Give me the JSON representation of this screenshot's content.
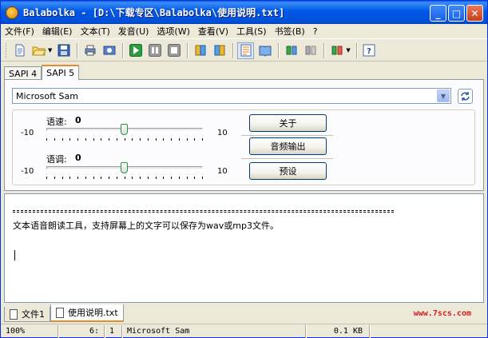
{
  "window": {
    "title": "Balabolka - [D:\\下载专区\\Balabolka\\使用说明.txt]",
    "minimize": "_",
    "maximize": "□",
    "close": "✕"
  },
  "menu": [
    "文件(F)",
    "编辑(E)",
    "文本(T)",
    "发音(U)",
    "选项(W)",
    "查看(V)",
    "工具(S)",
    "书签(B)",
    "?"
  ],
  "toolbar": {
    "icons": [
      "new-document-icon",
      "open-folder-icon",
      "save-icon",
      "print-icon",
      "convert-icon",
      "play-icon",
      "pause-icon",
      "stop-icon",
      "prev-icon",
      "next-icon",
      "text-view-icon",
      "book-icon",
      "speaker-left-icon",
      "speaker-right-icon",
      "speaker-menu-icon",
      "help-icon"
    ]
  },
  "sapi_tabs": [
    "SAPI 4",
    "SAPI 5"
  ],
  "voice": {
    "selected": "Microsoft Sam"
  },
  "sliders": {
    "rate": {
      "label": "语速:",
      "value": "0",
      "min": "-10",
      "max": "10"
    },
    "pitch": {
      "label": "语调:",
      "value": "0",
      "min": "-10",
      "max": "10"
    }
  },
  "buttons": {
    "about": "关于",
    "audio_output": "音频输出",
    "presets": "预设"
  },
  "editor": {
    "separator": "============================================================",
    "line1": "文本语音朗读工具，支持屏幕上的文字可以保存为wav或mp3文件。"
  },
  "doc_tabs": [
    "文件1",
    "使用说明.txt"
  ],
  "watermark": "www.7scs.com",
  "status": {
    "zoom": "100%",
    "line": "6:",
    "col": "1",
    "voice": "Microsoft Sam",
    "size": "0.1 KB"
  },
  "colors": {
    "title_bar": "#0054e3",
    "tab_highlight": "#e68b2c",
    "watermark": "#d21f1f"
  }
}
